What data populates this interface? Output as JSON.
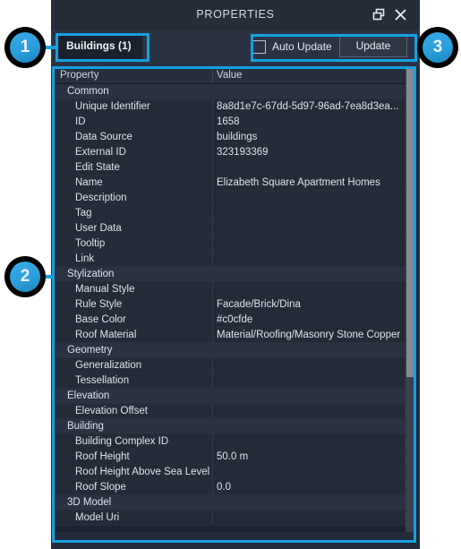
{
  "window": {
    "title": "PROPERTIES",
    "restore_icon": "restore-window-icon",
    "close_icon": "close-icon"
  },
  "toolbar": {
    "tab_label": "Buildings (1)",
    "auto_update_label": "Auto Update",
    "auto_update_checked": false,
    "update_button_label": "Update"
  },
  "grid": {
    "columns": [
      "Property",
      "Value"
    ],
    "rows": [
      {
        "type": "category",
        "property": "Common",
        "value": ""
      },
      {
        "type": "item",
        "property": "Unique Identifier",
        "value": "8a8d1e7c-67dd-5d97-96ad-7ea8d3ea..."
      },
      {
        "type": "item",
        "property": "ID",
        "value": "1658"
      },
      {
        "type": "item",
        "property": "Data Source",
        "value": "buildings"
      },
      {
        "type": "item",
        "property": "External ID",
        "value": "323193369"
      },
      {
        "type": "item",
        "property": "Edit State",
        "value": ""
      },
      {
        "type": "item",
        "property": "Name",
        "value": "Elizabeth Square Apartment Homes"
      },
      {
        "type": "item",
        "property": "Description",
        "value": ""
      },
      {
        "type": "item",
        "property": "Tag",
        "value": ""
      },
      {
        "type": "item",
        "property": "User Data",
        "value": ""
      },
      {
        "type": "item",
        "property": "Tooltip",
        "value": ""
      },
      {
        "type": "item",
        "property": "Link",
        "value": ""
      },
      {
        "type": "category",
        "property": "Stylization",
        "value": ""
      },
      {
        "type": "item",
        "property": "Manual Style",
        "value": ""
      },
      {
        "type": "item",
        "property": "Rule Style",
        "value": "Facade/Brick/Dina"
      },
      {
        "type": "item",
        "property": "Base Color",
        "value": "#c0cfde"
      },
      {
        "type": "item",
        "property": "Roof Material",
        "value": "Material/Roofing/Masonry Stone Copper"
      },
      {
        "type": "category",
        "property": "Geometry",
        "value": ""
      },
      {
        "type": "item",
        "property": "Generalization",
        "value": ""
      },
      {
        "type": "item",
        "property": "Tessellation",
        "value": ""
      },
      {
        "type": "category",
        "property": "Elevation",
        "value": ""
      },
      {
        "type": "item",
        "property": "Elevation Offset",
        "value": ""
      },
      {
        "type": "category",
        "property": "Building",
        "value": ""
      },
      {
        "type": "item",
        "property": "Building Complex ID",
        "value": ""
      },
      {
        "type": "item",
        "property": "Roof Height",
        "value": "50.0 m"
      },
      {
        "type": "item",
        "property": "Roof Height Above Sea Level",
        "value": ""
      },
      {
        "type": "item",
        "property": "Roof Slope",
        "value": "0.0"
      },
      {
        "type": "category",
        "property": "3D Model",
        "value": ""
      },
      {
        "type": "item",
        "property": "Model Uri",
        "value": ""
      }
    ]
  },
  "callouts": [
    {
      "number": "1"
    },
    {
      "number": "2"
    },
    {
      "number": "3"
    }
  ],
  "colors": {
    "accent": "#14a0e0",
    "panel_bg": "#252b38",
    "grid_bg": "#1d2330",
    "category_row": "#2a3140",
    "item_row": "#242a37",
    "text": "#dde4ee"
  }
}
